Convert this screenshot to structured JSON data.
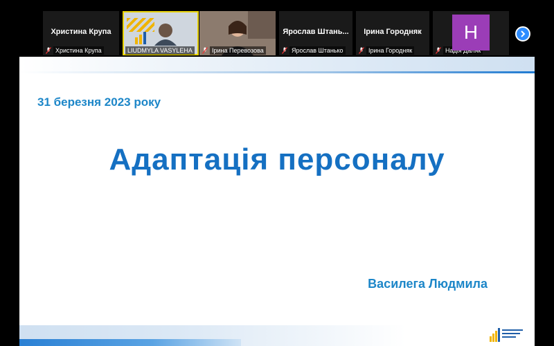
{
  "participants": [
    {
      "display_name": "Христина Крупа",
      "label": "Христина Крупа",
      "muted": true
    },
    {
      "display_name": "",
      "label": "LIUDMYLA VASYLEHA",
      "muted": false,
      "active_speaker": true
    },
    {
      "display_name": "",
      "label": "Ірина Перевозова",
      "muted": true
    },
    {
      "display_name": "Ярослав  Штань...",
      "label": "Ярослав Штанько",
      "muted": true
    },
    {
      "display_name": "Ірина Городняк",
      "label": "Ірина Городняк",
      "muted": true
    },
    {
      "display_name": "",
      "label": "Надія Даляк",
      "muted": true,
      "avatar_letter": "H"
    }
  ],
  "slide": {
    "date": "31 березня 2023 року",
    "title": "Адаптація персоналу",
    "author": "Василега Людмила"
  },
  "colors": {
    "accent": "#1570c2",
    "date_text": "#1c86c8",
    "avatar_bg": "#9b3db7",
    "next_button": "#2d8cff",
    "logo_yellow": "#f0b400"
  }
}
